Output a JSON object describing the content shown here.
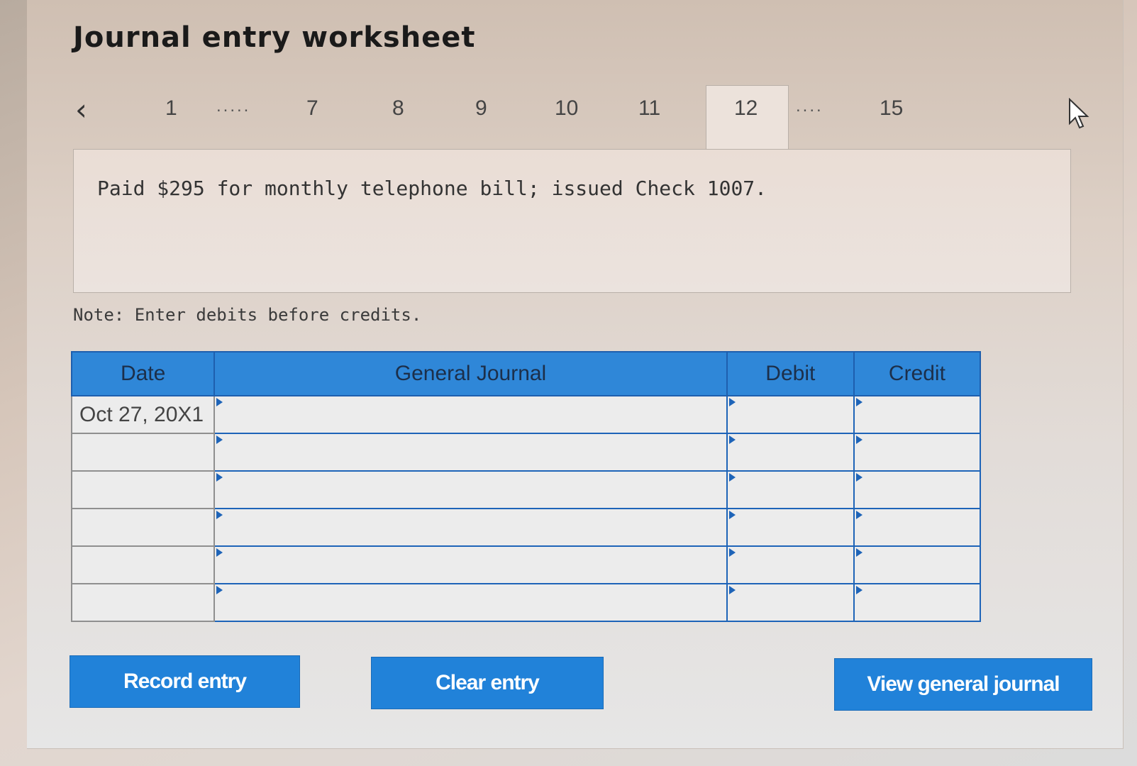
{
  "title": "Journal entry worksheet",
  "nav": {
    "pages": [
      "1",
      "7",
      "8",
      "9",
      "10",
      "11",
      "12",
      "15"
    ],
    "active": "12",
    "ellipsis_1": ".....",
    "ellipsis_2": "...."
  },
  "question": "Paid $295 for monthly telephone bill; issued Check 1007.",
  "note": "Note: Enter debits before credits.",
  "table": {
    "headers": {
      "date": "Date",
      "journal": "General Journal",
      "debit": "Debit",
      "credit": "Credit"
    },
    "rows": [
      {
        "date": "Oct 27, 20X1",
        "account": "",
        "debit": "",
        "credit": ""
      },
      {
        "date": "",
        "account": "",
        "debit": "",
        "credit": ""
      },
      {
        "date": "",
        "account": "",
        "debit": "",
        "credit": ""
      },
      {
        "date": "",
        "account": "",
        "debit": "",
        "credit": ""
      },
      {
        "date": "",
        "account": "",
        "debit": "",
        "credit": ""
      },
      {
        "date": "",
        "account": "",
        "debit": "",
        "credit": ""
      }
    ]
  },
  "buttons": {
    "record": "Record entry",
    "clear": "Clear entry",
    "view": "View general journal"
  },
  "colors": {
    "accent": "#2182d9",
    "table_border": "#1e64b8"
  }
}
